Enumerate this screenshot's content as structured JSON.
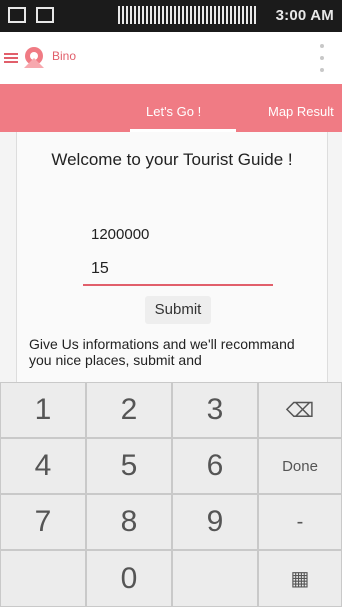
{
  "status": {
    "time": "3:00 AM"
  },
  "appbar": {
    "title": "Bino"
  },
  "tabs": {
    "active": "Let's Go !",
    "other": "Map Result"
  },
  "form": {
    "welcome": "Welcome to your Tourist Guide !",
    "budget_value": "1200000",
    "days_value": "15",
    "submit_label": "Submit",
    "info_text": "Give Us informations and we'll recommand you nice places, submit and"
  },
  "keyboard": {
    "k1": "1",
    "k2": "2",
    "k3": "3",
    "backspace": "⌫",
    "k4": "4",
    "k5": "5",
    "k6": "6",
    "done": "Done",
    "k7": "7",
    "k8": "8",
    "k9": "9",
    "dash": "-",
    "k0": "0",
    "settings": "▦"
  }
}
